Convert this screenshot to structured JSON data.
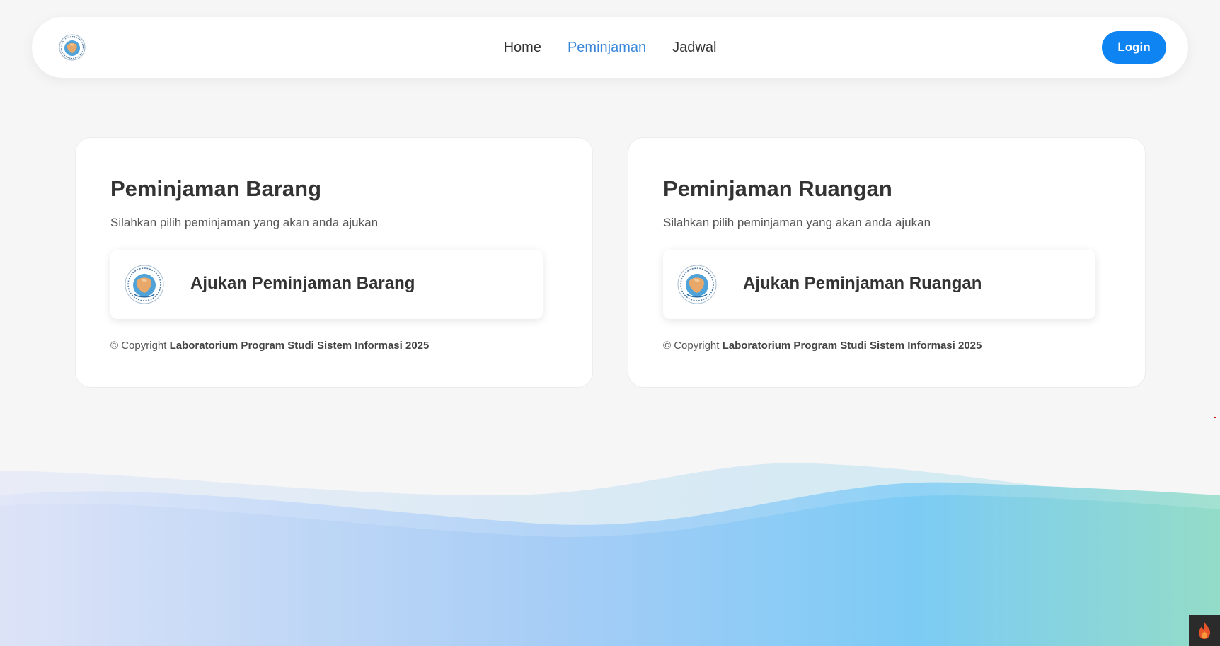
{
  "nav": {
    "links": [
      "Home",
      "Peminjaman",
      "Jadwal"
    ],
    "active": "Peminjaman",
    "login_label": "Login",
    "logo_icon": "globe-seal-icon"
  },
  "cards": [
    {
      "title": "Peminjaman Barang",
      "subtitle": "Silahkan pilih peminjaman yang akan anda ajukan",
      "action_label": "Ajukan Peminjaman Barang",
      "copyright_prefix": "© Copyright",
      "copyright_bold": "Laboratorium Program Studi Sistem Informasi 2025"
    },
    {
      "title": "Peminjaman Ruangan",
      "subtitle": "Silahkan pilih peminjaman yang akan anda ajukan",
      "action_label": "Ajukan Peminjaman Ruangan",
      "copyright_prefix": "© Copyright",
      "copyright_bold": "Laboratorium Program Studi Sistem Informasi 2025"
    }
  ],
  "colors": {
    "accent": "#0d84f2",
    "active_link": "#3a87d8",
    "background": "#f6f6f6"
  }
}
